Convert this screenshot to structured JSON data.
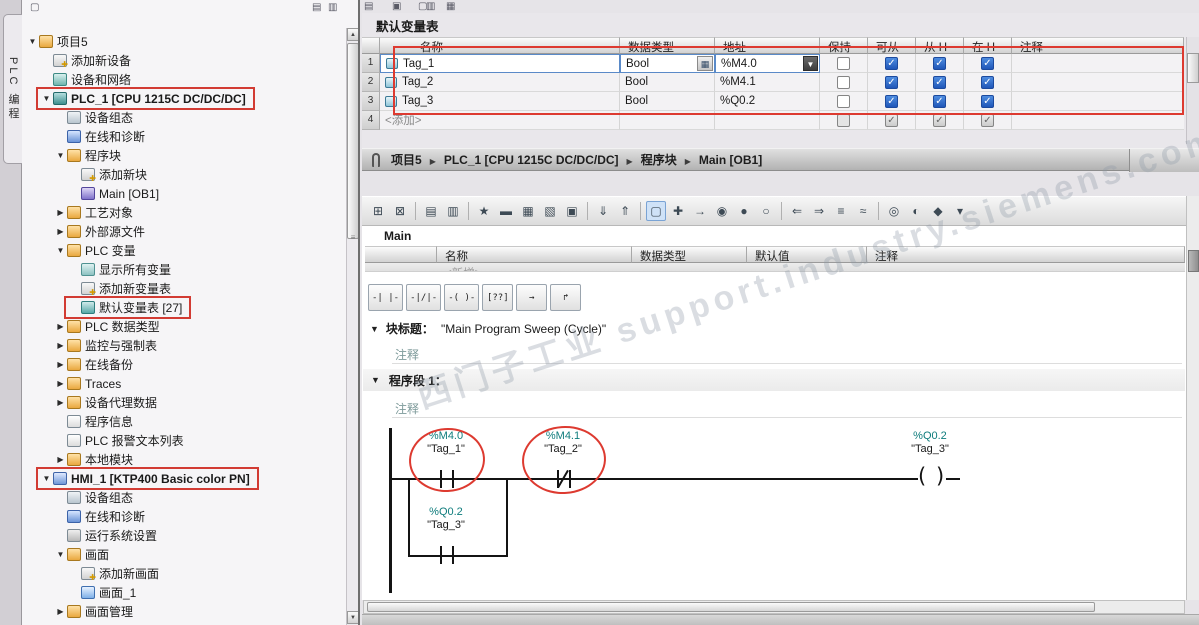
{
  "left_rail": {
    "label": "PLC 编程"
  },
  "tree": {
    "items": [
      {
        "label": "项目5",
        "level": 0,
        "expand": "open",
        "icon": "project"
      },
      {
        "label": "添加新设备",
        "level": 1,
        "icon": "add"
      },
      {
        "label": "设备和网络",
        "level": 1,
        "icon": "network"
      },
      {
        "label": "PLC_1 [CPU 1215C DC/DC/DC]",
        "level": 1,
        "expand": "open",
        "icon": "plc",
        "bold": true,
        "highlight": true
      },
      {
        "label": "设备组态",
        "level": 2,
        "icon": "config"
      },
      {
        "label": "在线和诊断",
        "level": 2,
        "icon": "diag"
      },
      {
        "label": "程序块",
        "level": 2,
        "expand": "open",
        "icon": "folder"
      },
      {
        "label": "添加新块",
        "level": 3,
        "icon": "add"
      },
      {
        "label": "Main [OB1]",
        "level": 3,
        "icon": "ob"
      },
      {
        "label": "工艺对象",
        "level": 2,
        "expand": "closed",
        "icon": "folder"
      },
      {
        "label": "外部源文件",
        "level": 2,
        "expand": "closed",
        "icon": "folder"
      },
      {
        "label": "PLC 变量",
        "level": 2,
        "expand": "open",
        "icon": "folder"
      },
      {
        "label": "显示所有变量",
        "level": 3,
        "icon": "taglist"
      },
      {
        "label": "添加新变量表",
        "level": 3,
        "icon": "add"
      },
      {
        "label": "默认变量表 [27]",
        "level": 3,
        "icon": "tagtable",
        "highlight": true
      },
      {
        "label": "PLC 数据类型",
        "level": 2,
        "expand": "closed",
        "icon": "folder"
      },
      {
        "label": "监控与强制表",
        "level": 2,
        "expand": "closed",
        "icon": "folder"
      },
      {
        "label": "在线备份",
        "level": 2,
        "expand": "closed",
        "icon": "folder"
      },
      {
        "label": "Traces",
        "level": 2,
        "expand": "closed",
        "icon": "folder"
      },
      {
        "label": "设备代理数据",
        "level": 2,
        "expand": "closed",
        "icon": "folder"
      },
      {
        "label": "程序信息",
        "level": 2,
        "icon": "page"
      },
      {
        "label": "PLC 报警文本列表",
        "level": 2,
        "icon": "page"
      },
      {
        "label": "本地模块",
        "level": 2,
        "expand": "closed",
        "icon": "folder"
      },
      {
        "label": "HMI_1 [KTP400 Basic color PN]",
        "level": 1,
        "expand": "open",
        "icon": "hmi",
        "bold": true,
        "highlight": true
      },
      {
        "label": "设备组态",
        "level": 2,
        "icon": "config"
      },
      {
        "label": "在线和诊断",
        "level": 2,
        "icon": "diag"
      },
      {
        "label": "运行系统设置",
        "level": 2,
        "icon": "gear"
      },
      {
        "label": "画面",
        "level": 2,
        "expand": "open",
        "icon": "folder"
      },
      {
        "label": "添加新画面",
        "level": 3,
        "icon": "add"
      },
      {
        "label": "画面_1",
        "level": 3,
        "icon": "screen"
      },
      {
        "label": "画面管理",
        "level": 2,
        "expand": "closed",
        "icon": "folder"
      }
    ]
  },
  "top_icons": [
    {
      "name": "window-icon",
      "glyph": "▤"
    },
    {
      "name": "copy-page-icon",
      "glyph": "▣"
    },
    {
      "name": "new-page-icon",
      "glyph": "▢"
    },
    {
      "name": "split-icon",
      "glyph": "▥"
    },
    {
      "name": "grid-icon",
      "glyph": "▦"
    }
  ],
  "tag_table": {
    "title": "默认变量表",
    "columns": [
      "名称",
      "数据类型",
      "地址",
      "保持",
      "可从",
      "从 H",
      "在 H",
      "注释"
    ],
    "rows": [
      {
        "num": "1",
        "name": "Tag_1",
        "type": "Bool",
        "address": "%M4.0",
        "selected": true,
        "checks": [
          "empty",
          "blue",
          "blue",
          "blue"
        ]
      },
      {
        "num": "2",
        "name": "Tag_2",
        "type": "Bool",
        "address": "%M4.1",
        "checks": [
          "empty",
          "blue",
          "blue",
          "blue"
        ]
      },
      {
        "num": "3",
        "name": "Tag_3",
        "type": "Bool",
        "address": "%Q0.2",
        "checks": [
          "empty",
          "blue",
          "blue",
          "blue"
        ]
      },
      {
        "num": "4",
        "name": "<添加>",
        "type": "",
        "address": "",
        "add_row": true,
        "checks": [
          "grayempty",
          "gray",
          "gray",
          "gray"
        ]
      }
    ]
  },
  "breadcrumb": {
    "items": [
      "项目5",
      "PLC_1 [CPU 1215C DC/DC/DC]",
      "程序块",
      "Main [OB1]"
    ]
  },
  "toolbar": {
    "icons": [
      {
        "name": "insert-network-icon",
        "glyph": "⊞"
      },
      {
        "name": "delete-network-icon",
        "glyph": "⊠",
        "sep": true
      },
      {
        "name": "open-all-networks-icon",
        "glyph": "▤"
      },
      {
        "name": "close-all-networks-icon",
        "glyph": "▥",
        "sep": true
      },
      {
        "name": "favorites-icon",
        "glyph": "★"
      },
      {
        "name": "comments-icon",
        "glyph": "▬"
      },
      {
        "name": "absolute-operands-icon",
        "glyph": "▦"
      },
      {
        "name": "network-comments-icon",
        "glyph": "▧"
      },
      {
        "name": "show-symbols-icon",
        "glyph": "▣",
        "sep": true
      },
      {
        "name": "download-icon",
        "glyph": "⇓"
      },
      {
        "name": "upload-icon",
        "glyph": "⇑",
        "sep": true
      },
      {
        "name": "box-instruction-icon",
        "glyph": "▢",
        "active": true
      },
      {
        "name": "free-comment-icon",
        "glyph": "✚"
      },
      {
        "name": "jump-to-icon",
        "glyph": "→"
      },
      {
        "name": "status-dot-icon",
        "glyph": "◉"
      },
      {
        "name": "status-on-icon",
        "glyph": "●"
      },
      {
        "name": "status-off-icon",
        "glyph": "○",
        "sep": true
      },
      {
        "name": "back-icon",
        "glyph": "⇐"
      },
      {
        "name": "forward-icon",
        "glyph": "⇒"
      },
      {
        "name": "list-icon",
        "glyph": "≡"
      },
      {
        "name": "compare-icon",
        "glyph": "≈",
        "sep": true
      },
      {
        "name": "glasses-icon",
        "glyph": "◎"
      },
      {
        "name": "monitor-icon",
        "glyph": "◐"
      },
      {
        "name": "settings-icon",
        "glyph": "◆"
      },
      {
        "name": "more-options-icon",
        "glyph": "▾"
      }
    ]
  },
  "editor": {
    "name": "Main",
    "interface_columns": [
      "名称",
      "数据类型",
      "默认值",
      "注释"
    ],
    "interface_add_row": "<新增>",
    "lad_buttons": [
      {
        "name": "no-contact-button",
        "label": "-| |-"
      },
      {
        "name": "nc-contact-button",
        "label": "-|/|-"
      },
      {
        "name": "coil-button",
        "label": "-( )-"
      },
      {
        "name": "empty-box-button",
        "label": "[??]"
      },
      {
        "name": "open-branch-button",
        "label": "→"
      },
      {
        "name": "close-branch-button",
        "label": "↱"
      }
    ],
    "block_title_label": "块标题：",
    "block_title_value": "\"Main Program Sweep (Cycle)\"",
    "comment_text": "注释",
    "network": {
      "label": "程序段 1：",
      "comment": "注释"
    },
    "ladder": {
      "contact1": {
        "address": "%M4.0",
        "name": "\"Tag_1\""
      },
      "contact2": {
        "address": "%M4.1",
        "name": "\"Tag_2\""
      },
      "coil": {
        "address": "%Q0.2",
        "name": "\"Tag_3\""
      },
      "branch_contact": {
        "address": "%Q0.2",
        "name": "\"Tag_3\""
      }
    }
  },
  "watermark": {
    "text": "西门子工业 support.industry.siemens.com 技术论坛"
  }
}
